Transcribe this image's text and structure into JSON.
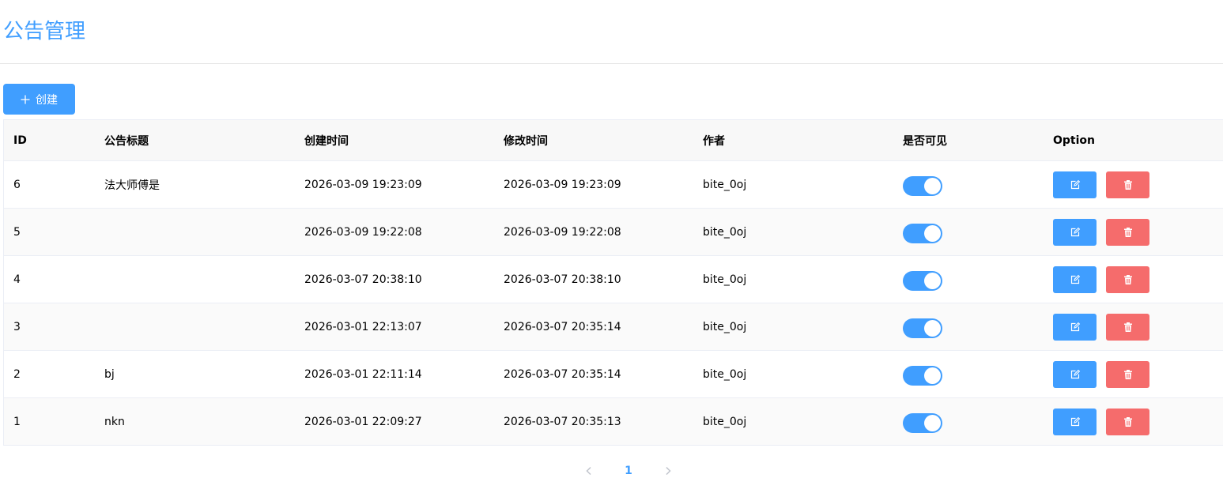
{
  "page": {
    "title": "公告管理"
  },
  "toolbar": {
    "create_label": "创建"
  },
  "table": {
    "headers": {
      "id": "ID",
      "title": "公告标题",
      "created": "创建时间",
      "modified": "修改时间",
      "author": "作者",
      "visible": "是否可见",
      "option": "Option"
    },
    "rows": [
      {
        "id": "6",
        "title": "法大师傅是",
        "created": "2026-03-09 19:23:09",
        "modified": "2026-03-09 19:23:09",
        "author": "bite_0oj",
        "visible": true
      },
      {
        "id": "5",
        "title": "",
        "created": "2026-03-09 19:22:08",
        "modified": "2026-03-09 19:22:08",
        "author": "bite_0oj",
        "visible": true
      },
      {
        "id": "4",
        "title": "",
        "created": "2026-03-07 20:38:10",
        "modified": "2026-03-07 20:38:10",
        "author": "bite_0oj",
        "visible": true
      },
      {
        "id": "3",
        "title": "",
        "created": "2026-03-01 22:13:07",
        "modified": "2026-03-07 20:35:14",
        "author": "bite_0oj",
        "visible": true
      },
      {
        "id": "2",
        "title": "bj",
        "created": "2026-03-01 22:11:14",
        "modified": "2026-03-07 20:35:14",
        "author": "bite_0oj",
        "visible": true
      },
      {
        "id": "1",
        "title": "nkn",
        "created": "2026-03-01 22:09:27",
        "modified": "2026-03-07 20:35:13",
        "author": "bite_0oj",
        "visible": true
      }
    ]
  },
  "pagination": {
    "current_page": "1"
  },
  "icons": {
    "create": "plus-icon",
    "edit": "edit-icon",
    "delete": "trash-icon",
    "prev": "chevron-left-icon",
    "next": "chevron-right-icon"
  },
  "colors": {
    "primary": "#409eff",
    "danger": "#f56c6c",
    "header_bg": "#f8f8f8"
  }
}
